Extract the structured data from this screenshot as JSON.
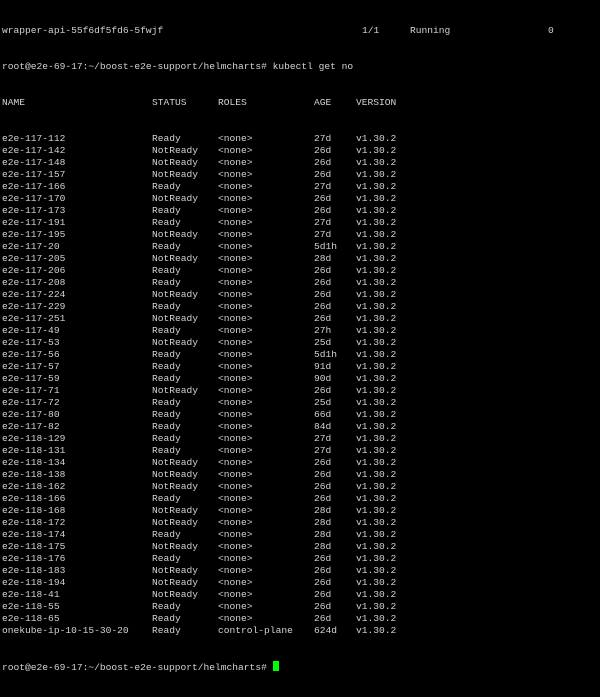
{
  "terminal": {
    "first_line": {
      "name": "wrapper-api-55f6df5fd6-5fwjf",
      "ready": "1/1",
      "status": "Running",
      "restarts": "0"
    },
    "prompt_1": "root@e2e-69-17:~/boost-e2e-support/helmcharts# kubectl get no",
    "headers": {
      "name": "NAME",
      "status": "STATUS",
      "roles": "ROLES",
      "age": "AGE",
      "version": "VERSION"
    },
    "nodes": [
      {
        "name": "e2e-117-112",
        "status": "Ready",
        "roles": "<none>",
        "age": "27d",
        "version": "v1.30.2"
      },
      {
        "name": "e2e-117-142",
        "status": "NotReady",
        "roles": "<none>",
        "age": "26d",
        "version": "v1.30.2"
      },
      {
        "name": "e2e-117-148",
        "status": "NotReady",
        "roles": "<none>",
        "age": "26d",
        "version": "v1.30.2"
      },
      {
        "name": "e2e-117-157",
        "status": "NotReady",
        "roles": "<none>",
        "age": "26d",
        "version": "v1.30.2"
      },
      {
        "name": "e2e-117-166",
        "status": "Ready",
        "roles": "<none>",
        "age": "27d",
        "version": "v1.30.2"
      },
      {
        "name": "e2e-117-170",
        "status": "NotReady",
        "roles": "<none>",
        "age": "26d",
        "version": "v1.30.2"
      },
      {
        "name": "e2e-117-173",
        "status": "Ready",
        "roles": "<none>",
        "age": "26d",
        "version": "v1.30.2"
      },
      {
        "name": "e2e-117-191",
        "status": "Ready",
        "roles": "<none>",
        "age": "27d",
        "version": "v1.30.2"
      },
      {
        "name": "e2e-117-195",
        "status": "NotReady",
        "roles": "<none>",
        "age": "27d",
        "version": "v1.30.2"
      },
      {
        "name": "e2e-117-20",
        "status": "Ready",
        "roles": "<none>",
        "age": "5d1h",
        "version": "v1.30.2"
      },
      {
        "name": "e2e-117-205",
        "status": "NotReady",
        "roles": "<none>",
        "age": "28d",
        "version": "v1.30.2"
      },
      {
        "name": "e2e-117-206",
        "status": "Ready",
        "roles": "<none>",
        "age": "26d",
        "version": "v1.30.2"
      },
      {
        "name": "e2e-117-208",
        "status": "Ready",
        "roles": "<none>",
        "age": "26d",
        "version": "v1.30.2"
      },
      {
        "name": "e2e-117-224",
        "status": "NotReady",
        "roles": "<none>",
        "age": "26d",
        "version": "v1.30.2"
      },
      {
        "name": "e2e-117-229",
        "status": "Ready",
        "roles": "<none>",
        "age": "26d",
        "version": "v1.30.2"
      },
      {
        "name": "e2e-117-251",
        "status": "NotReady",
        "roles": "<none>",
        "age": "26d",
        "version": "v1.30.2"
      },
      {
        "name": "e2e-117-49",
        "status": "Ready",
        "roles": "<none>",
        "age": "27h",
        "version": "v1.30.2"
      },
      {
        "name": "e2e-117-53",
        "status": "NotReady",
        "roles": "<none>",
        "age": "25d",
        "version": "v1.30.2"
      },
      {
        "name": "e2e-117-56",
        "status": "Ready",
        "roles": "<none>",
        "age": "5d1h",
        "version": "v1.30.2"
      },
      {
        "name": "e2e-117-57",
        "status": "Ready",
        "roles": "<none>",
        "age": "91d",
        "version": "v1.30.2"
      },
      {
        "name": "e2e-117-59",
        "status": "Ready",
        "roles": "<none>",
        "age": "90d",
        "version": "v1.30.2"
      },
      {
        "name": "e2e-117-71",
        "status": "NotReady",
        "roles": "<none>",
        "age": "26d",
        "version": "v1.30.2"
      },
      {
        "name": "e2e-117-72",
        "status": "Ready",
        "roles": "<none>",
        "age": "25d",
        "version": "v1.30.2"
      },
      {
        "name": "e2e-117-80",
        "status": "Ready",
        "roles": "<none>",
        "age": "66d",
        "version": "v1.30.2"
      },
      {
        "name": "e2e-117-82",
        "status": "Ready",
        "roles": "<none>",
        "age": "84d",
        "version": "v1.30.2"
      },
      {
        "name": "e2e-118-129",
        "status": "Ready",
        "roles": "<none>",
        "age": "27d",
        "version": "v1.30.2"
      },
      {
        "name": "e2e-118-131",
        "status": "Ready",
        "roles": "<none>",
        "age": "27d",
        "version": "v1.30.2"
      },
      {
        "name": "e2e-118-134",
        "status": "NotReady",
        "roles": "<none>",
        "age": "26d",
        "version": "v1.30.2"
      },
      {
        "name": "e2e-118-138",
        "status": "NotReady",
        "roles": "<none>",
        "age": "26d",
        "version": "v1.30.2"
      },
      {
        "name": "e2e-118-162",
        "status": "NotReady",
        "roles": "<none>",
        "age": "26d",
        "version": "v1.30.2"
      },
      {
        "name": "e2e-118-166",
        "status": "Ready",
        "roles": "<none>",
        "age": "26d",
        "version": "v1.30.2"
      },
      {
        "name": "e2e-118-168",
        "status": "NotReady",
        "roles": "<none>",
        "age": "28d",
        "version": "v1.30.2"
      },
      {
        "name": "e2e-118-172",
        "status": "NotReady",
        "roles": "<none>",
        "age": "28d",
        "version": "v1.30.2"
      },
      {
        "name": "e2e-118-174",
        "status": "Ready",
        "roles": "<none>",
        "age": "28d",
        "version": "v1.30.2"
      },
      {
        "name": "e2e-118-175",
        "status": "NotReady",
        "roles": "<none>",
        "age": "28d",
        "version": "v1.30.2"
      },
      {
        "name": "e2e-118-176",
        "status": "Ready",
        "roles": "<none>",
        "age": "26d",
        "version": "v1.30.2"
      },
      {
        "name": "e2e-118-183",
        "status": "NotReady",
        "roles": "<none>",
        "age": "26d",
        "version": "v1.30.2"
      },
      {
        "name": "e2e-118-194",
        "status": "NotReady",
        "roles": "<none>",
        "age": "26d",
        "version": "v1.30.2"
      },
      {
        "name": "e2e-118-41",
        "status": "NotReady",
        "roles": "<none>",
        "age": "26d",
        "version": "v1.30.2"
      },
      {
        "name": "e2e-118-55",
        "status": "Ready",
        "roles": "<none>",
        "age": "26d",
        "version": "v1.30.2"
      },
      {
        "name": "e2e-118-65",
        "status": "Ready",
        "roles": "<none>",
        "age": "26d",
        "version": "v1.30.2"
      },
      {
        "name": "onekube-ip-10-15-30-20",
        "status": "Ready",
        "roles": "control-plane",
        "age": "624d",
        "version": "v1.30.2"
      }
    ],
    "prompt_2": "root@e2e-69-17:~/boost-e2e-support/helmcharts#",
    "colors": {
      "background": "#000000",
      "text": "#d3d3d3",
      "cursor": "#00ff00"
    }
  }
}
